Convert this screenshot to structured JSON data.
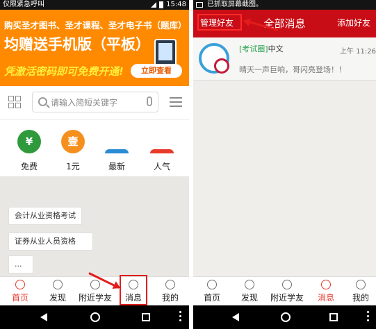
{
  "left": {
    "status": {
      "carrier": "仅限紧急呼叫",
      "time": "15:48"
    },
    "banner": {
      "line1": "购买圣才图书、圣才课程、圣才电子书（题库）",
      "line2": "均赠送手机版（平板）",
      "line3": "凭激活密码即可免费开通!",
      "cta": "立即查看"
    },
    "search": {
      "placeholder": "请输入简短关键字"
    },
    "categories": [
      {
        "label": "免费",
        "glyph": "¥",
        "color": "#2f9a3c"
      },
      {
        "label": "1元",
        "glyph": "壹",
        "color": "#f5901e"
      },
      {
        "label": "最新",
        "glyph": "",
        "color": "#2a8cd4"
      },
      {
        "label": "人气",
        "glyph": "",
        "color": "#e83a2a"
      }
    ],
    "tags": [
      "会计从业资格考试",
      "证券从业人员资格",
      "..."
    ],
    "tabs": [
      {
        "label": "首页",
        "icon": "home-icon"
      },
      {
        "label": "发现",
        "icon": "compass-icon"
      },
      {
        "label": "附近学友",
        "icon": "location-pin-icon"
      },
      {
        "label": "消息",
        "icon": "message-icon"
      },
      {
        "label": "我的",
        "icon": "person-icon"
      }
    ],
    "active_tab": 0,
    "accent": "#e53a2f"
  },
  "right": {
    "status": {
      "text": "已抓取屏幕截图。"
    },
    "header": {
      "manage": "管理好友",
      "title": "全部消息",
      "add": "添加好友"
    },
    "message": {
      "tag": "[考试圈]",
      "name": "中文",
      "time": "上午 11:26",
      "preview": "晴天一声巨响，哥闪亮登场！！"
    },
    "tabs": [
      {
        "label": "首页",
        "icon": "home-icon"
      },
      {
        "label": "发现",
        "icon": "compass-icon"
      },
      {
        "label": "附近学友",
        "icon": "location-pin-icon"
      },
      {
        "label": "消息",
        "icon": "message-icon"
      },
      {
        "label": "我的",
        "icon": "person-icon"
      }
    ],
    "active_tab": 3,
    "accent": "#c90d16"
  }
}
